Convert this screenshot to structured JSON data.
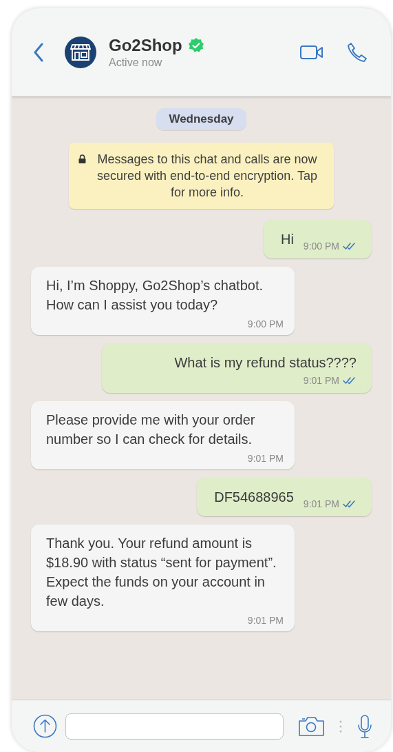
{
  "contact": {
    "name": "Go2Shop",
    "verified": true,
    "status": "Active now"
  },
  "date_chip": "Wednesday",
  "security_notice": "Messages to this chat and calls are now secured with end-to-end encryption. Tap for more info.",
  "messages": [
    {
      "kind": "sent",
      "text": "Hi",
      "time": "9:00 PM",
      "read": true
    },
    {
      "kind": "received",
      "text": "Hi, I’m Shoppy, Go2Shop’s chatbot. How can I assist you today?",
      "time": "9:00 PM"
    },
    {
      "kind": "sent",
      "text": "What is my refund status????",
      "time": "9:01 PM",
      "read": true
    },
    {
      "kind": "received",
      "text": "Please provide me with your order number so I can check for details.",
      "time": "9:01 PM"
    },
    {
      "kind": "sent",
      "text": "DF54688965",
      "time": "9:01 PM",
      "read": true
    },
    {
      "kind": "received",
      "text": "Thank you. Your refund amount is $18.90 with status “sent for payment”. Expect the funds on your account in few days.",
      "time": "9:01 PM"
    }
  ]
}
